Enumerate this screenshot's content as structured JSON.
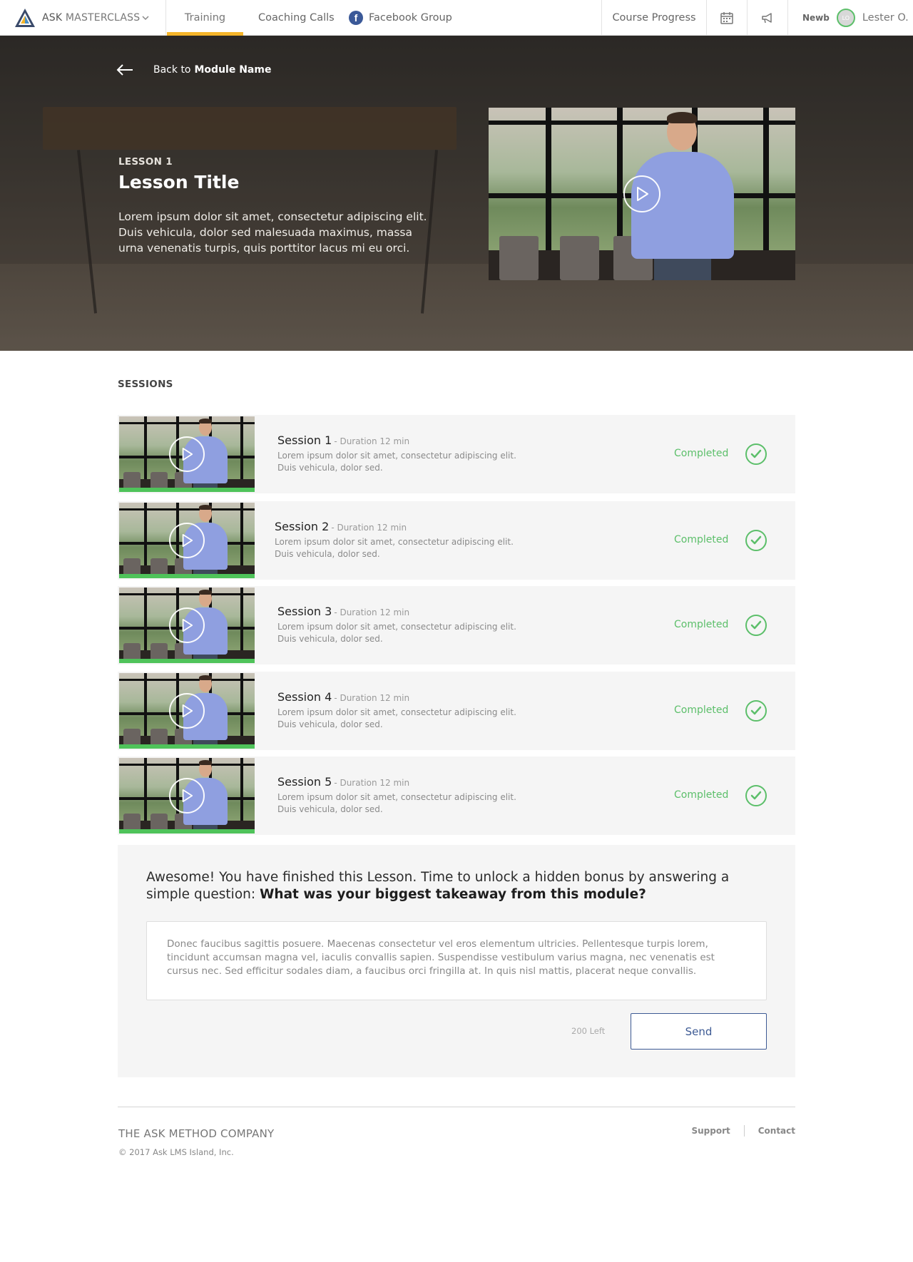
{
  "nav": {
    "brand_first": "ASK",
    "brand_second": "MASTERCLASS",
    "logo_icon": "triangle-logo-icon",
    "dropdown_icon": "chevron-down-icon",
    "tabs": [
      {
        "label": "Training",
        "active": true
      },
      {
        "label": "Coaching Calls",
        "active": false
      },
      {
        "label": "Facebook Group",
        "active": false,
        "icon": "facebook-icon"
      }
    ],
    "facebook_glyph": "f",
    "course_progress": "Course Progress",
    "calendar_icon": "calendar-icon",
    "announcement_icon": "megaphone-icon",
    "user": {
      "rank": "Newb",
      "initials": "LO",
      "name": "Lester O."
    },
    "accent_color": "#f5b52a"
  },
  "hero": {
    "back_prefix": "Back to",
    "back_target": "Module Name",
    "lesson_label": "LESSON 1",
    "lesson_title": "Lesson Title",
    "description": "Lorem ipsum dolor sit amet, consectetur adipiscing elit. Duis vehicula, dolor sed malesuada maximus, massa urna venenatis turpis, quis porttitor lacus mi eu orci."
  },
  "sessions": {
    "heading": "SESSIONS",
    "items": [
      {
        "title": "Session 1",
        "duration": "- Duration 12 min",
        "description": "Lorem ipsum dolor sit amet, consectetur adipiscing elit. Duis vehicula, dolor sed.",
        "status": "Completed",
        "progress": 1.0
      },
      {
        "title": "Session 2",
        "duration": "- Duration 12 min",
        "description": "Lorem ipsum dolor sit amet, consectetur adipiscing elit. Duis vehicula, dolor sed.",
        "status": "Completed",
        "progress": 1.0
      },
      {
        "title": "Session 3",
        "duration": "- Duration 12 min",
        "description": "Lorem ipsum dolor sit amet, consectetur adipiscing elit. Duis vehicula, dolor sed.",
        "status": "Completed",
        "progress": 1.0
      },
      {
        "title": "Session 4",
        "duration": "- Duration 12 min",
        "description": "Lorem ipsum dolor sit amet, consectetur adipiscing elit. Duis vehicula, dolor sed.",
        "status": "Completed",
        "progress": 1.0
      },
      {
        "title": "Session 5",
        "duration": "- Duration 12 min",
        "description": "Lorem ipsum dolor sit amet, consectetur adipiscing elit. Duis vehicula, dolor sed.",
        "status": "Completed",
        "progress": 1.0
      }
    ],
    "completed_color": "#5cbf6a"
  },
  "bonus": {
    "prompt": "Awesome! You have finished this Lesson. Time to unlock a hidden bonus by answering a simple question:",
    "question": "What was your biggest takeaway from this module?",
    "answer": "Donec faucibus sagittis posuere. Maecenas consectetur vel eros elementum ultricies. Pellentesque turpis lorem, tincidunt accumsan magna vel, iaculis convallis sapien. Suspendisse vestibulum varius magna, nec venenatis est cursus nec. Sed efficitur sodales diam, a faucibus orci fringilla at. In quis nisl mattis, placerat neque convallis.",
    "chars_left": "200 Left",
    "send_label": "Send",
    "button_color": "#3d5a94"
  },
  "footer": {
    "company": "THE ASK METHOD COMPANY",
    "copyright": "© 2017 Ask LMS Island, Inc.",
    "links": [
      "Support",
      "Contact"
    ]
  }
}
